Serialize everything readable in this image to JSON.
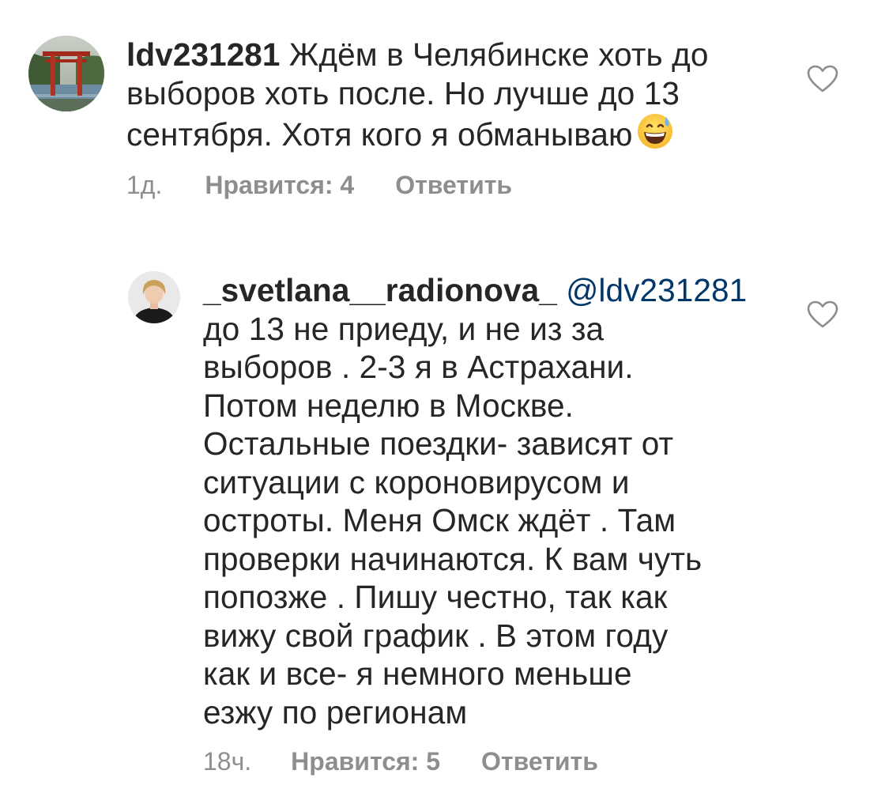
{
  "comments": [
    {
      "username": "ldv231281",
      "mention": "",
      "text_lines": [
        "Ждём в Челябинске хоть до",
        "выборов хоть после. Но лучше до 13",
        "сентября. Хотя кого я обманываю"
      ],
      "emoji": "grinning-face-with-sweat",
      "time": "1д.",
      "likes": "Нравится: 4",
      "reply": "Ответить"
    },
    {
      "username": "_svetlana__radionova_",
      "mention": "@ldv231281",
      "text_lines": [
        "до 13 не приеду, и не из за",
        "выборов . 2-3 я в Астрахани.",
        "Потом неделю в Москве.",
        "Остальные поездки- зависят от",
        "ситуации с короновирусом и",
        "остроты. Меня Омск ждёт . Там",
        "проверки начинаются. К вам чуть",
        "попозже . Пишу честно, так как",
        "вижу свой график . В этом году",
        "как и все- я немного меньше",
        "езжу по регионам"
      ],
      "emoji": "",
      "time": "18ч.",
      "likes": "Нравится: 5",
      "reply": "Ответить"
    }
  ],
  "icons": {
    "like": "heart-outline-icon"
  },
  "colors": {
    "text": "#262626",
    "secondary": "#8e8e8e",
    "mention": "#00376b"
  }
}
